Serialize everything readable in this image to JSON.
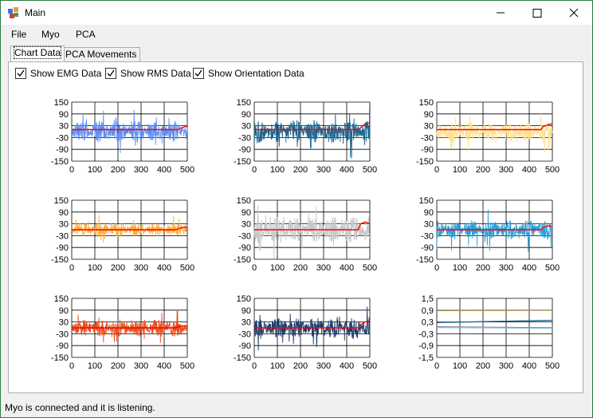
{
  "window": {
    "title": "Main"
  },
  "menu": {
    "items": [
      "File",
      "Myo",
      "PCA"
    ]
  },
  "tabs": [
    "Chart Data",
    "PCA Movements"
  ],
  "options": {
    "show_emg": {
      "label": "Show EMG Data",
      "checked": true
    },
    "show_rms": {
      "label": "Show RMS Data",
      "checked": true
    },
    "show_orientation": {
      "label": "Show Orientation Data",
      "checked": true
    }
  },
  "status": {
    "text": "Myo is connected and it is listening."
  },
  "chart_data": [
    {
      "type": "line",
      "xlim": [
        0,
        500
      ],
      "ylim": [
        -150,
        150
      ],
      "yticks": [
        "150",
        "90",
        "30",
        "-30",
        "-90",
        "-150"
      ],
      "xticks": [
        "0",
        "100",
        "200",
        "300",
        "400",
        "500"
      ],
      "grid": true,
      "series": [
        {
          "color": "#5b8ff9",
          "amplitude": 55,
          "x": [
            0,
            500
          ]
        },
        {
          "color": "#ff0000",
          "values": [
            10,
            10,
            10,
            22,
            28
          ],
          "x": [
            0,
            450,
            460,
            480,
            500
          ]
        }
      ]
    },
    {
      "type": "line",
      "xlim": [
        0,
        500
      ],
      "ylim": [
        -150,
        150
      ],
      "yticks": [
        "150",
        "90",
        "30",
        "-30",
        "-90",
        "-150"
      ],
      "xticks": [
        "0",
        "100",
        "200",
        "300",
        "400",
        "500"
      ],
      "grid": true,
      "series": [
        {
          "color": "#1a6890",
          "amplitude": 60,
          "x": [
            0,
            500
          ]
        },
        {
          "color": "#ff0000",
          "values": [
            10,
            10,
            20,
            40,
            45
          ],
          "x": [
            0,
            450,
            460,
            480,
            500
          ]
        }
      ]
    },
    {
      "type": "line",
      "xlim": [
        0,
        500
      ],
      "ylim": [
        -150,
        150
      ],
      "yticks": [
        "150",
        "90",
        "30",
        "-30",
        "-90",
        "-150"
      ],
      "xticks": [
        "0",
        "100",
        "200",
        "300",
        "400",
        "500"
      ],
      "grid": true,
      "series": [
        {
          "color": "#ffe08a",
          "amplitude": 50,
          "x": [
            0,
            500
          ]
        },
        {
          "color": "#ff0000",
          "values": [
            10,
            10,
            25,
            35,
            40
          ],
          "x": [
            0,
            450,
            460,
            480,
            500
          ]
        }
      ]
    },
    {
      "type": "line",
      "xlim": [
        0,
        500
      ],
      "ylim": [
        -150,
        150
      ],
      "yticks": [
        "150",
        "90",
        "30",
        "-30",
        "-90",
        "-150"
      ],
      "xticks": [
        "0",
        "100",
        "200",
        "300",
        "400",
        "500"
      ],
      "grid": true,
      "series": [
        {
          "color": "#ffae35",
          "amplitude": 35,
          "x": [
            0,
            500
          ]
        },
        {
          "color": "#ff0000",
          "values": [
            0,
            0,
            5,
            12,
            15
          ],
          "x": [
            0,
            450,
            460,
            480,
            500
          ]
        }
      ]
    },
    {
      "type": "line",
      "xlim": [
        0,
        500
      ],
      "ylim": [
        -150,
        150
      ],
      "yticks": [
        "150",
        "90",
        "30",
        "-30",
        "-90",
        "-150"
      ],
      "xticks": [
        "0",
        "100",
        "200",
        "300",
        "400",
        "500"
      ],
      "grid": true,
      "series": [
        {
          "color": "#c8c8c8",
          "amplitude": 70,
          "x": [
            0,
            500
          ]
        },
        {
          "color": "#ff0000",
          "values": [
            0,
            0,
            30,
            40,
            30
          ],
          "x": [
            0,
            450,
            460,
            480,
            500
          ]
        }
      ]
    },
    {
      "type": "line",
      "xlim": [
        0,
        500
      ],
      "ylim": [
        -150,
        150
      ],
      "yticks": [
        "150",
        "90",
        "30",
        "-30",
        "-90",
        "-150"
      ],
      "xticks": [
        "0",
        "100",
        "200",
        "300",
        "400",
        "500"
      ],
      "grid": true,
      "series": [
        {
          "color": "#2aa0dc",
          "amplitude": 50,
          "x": [
            0,
            500
          ]
        },
        {
          "color": "#ff0000",
          "values": [
            0,
            0,
            10,
            20,
            18
          ],
          "x": [
            0,
            450,
            460,
            480,
            500
          ]
        }
      ]
    },
    {
      "type": "line",
      "xlim": [
        0,
        500
      ],
      "ylim": [
        -150,
        150
      ],
      "yticks": [
        "150",
        "90",
        "30",
        "-30",
        "-90",
        "-150"
      ],
      "xticks": [
        "0",
        "100",
        "200",
        "300",
        "400",
        "500"
      ],
      "grid": true,
      "series": [
        {
          "color": "#e8501e",
          "amplitude": 45,
          "x": [
            0,
            500
          ]
        },
        {
          "color": "#ff0000",
          "values": [
            0,
            0,
            5,
            10,
            8
          ],
          "x": [
            0,
            450,
            460,
            480,
            500
          ]
        }
      ]
    },
    {
      "type": "line",
      "xlim": [
        0,
        500
      ],
      "ylim": [
        -150,
        150
      ],
      "yticks": [
        "150",
        "90",
        "30",
        "-30",
        "-90",
        "-150"
      ],
      "xticks": [
        "0",
        "100",
        "200",
        "300",
        "400",
        "500"
      ],
      "grid": true,
      "series": [
        {
          "color": "#1d3d6e",
          "amplitude": 55,
          "x": [
            0,
            500
          ]
        },
        {
          "color": "#ff0000",
          "values": [
            0,
            0,
            15,
            30,
            35
          ],
          "x": [
            0,
            450,
            460,
            480,
            500
          ]
        }
      ]
    },
    {
      "type": "line",
      "xlim": [
        0,
        500
      ],
      "ylim": [
        -1.5,
        1.5
      ],
      "yticks": [
        "1,5",
        "0,9",
        "0,3",
        "-0,3",
        "-0,9",
        "-1,5"
      ],
      "xticks": [
        "0",
        "100",
        "200",
        "300",
        "400",
        "500"
      ],
      "grid": true,
      "series": [
        {
          "color": "#a09050",
          "x": [
            0,
            500
          ],
          "values": [
            0.88,
            0.9
          ]
        },
        {
          "color": "#1a6890",
          "x": [
            0,
            500
          ],
          "values": [
            0.27,
            0.38
          ]
        },
        {
          "color": "#6b5070",
          "x": [
            0,
            500
          ],
          "values": [
            0.05,
            0.0
          ]
        },
        {
          "color": "#90c0e0",
          "x": [
            0,
            500
          ],
          "values": [
            0.02,
            -0.02
          ]
        }
      ]
    }
  ]
}
